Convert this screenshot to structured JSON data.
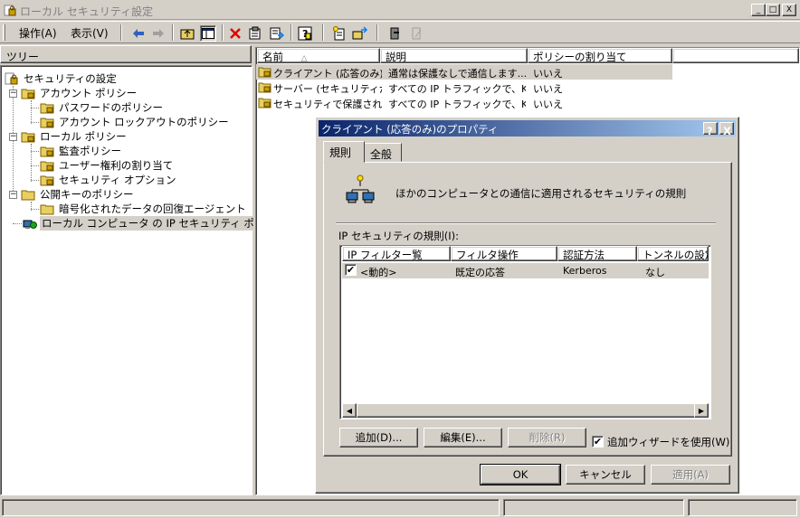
{
  "window": {
    "title": "ローカル セキュリティ設定",
    "minimize": "_",
    "maximize": "□",
    "close": "X"
  },
  "menu": {
    "action": "操作(A)",
    "view": "表示(V)"
  },
  "tree": {
    "header": "ツリー",
    "nodes": [
      {
        "label": "セキュリティの設定",
        "icon": "security-settings-icon"
      },
      {
        "label": "アカウント ポリシー",
        "icon": "folder-icon"
      },
      {
        "label": "パスワードのポリシー",
        "icon": "folder-icon"
      },
      {
        "label": "アカウント ロックアウトのポリシー",
        "icon": "folder-icon"
      },
      {
        "label": "ローカル ポリシー",
        "icon": "folder-icon"
      },
      {
        "label": "監査ポリシー",
        "icon": "folder-icon"
      },
      {
        "label": "ユーザー権利の割り当て",
        "icon": "folder-icon"
      },
      {
        "label": "セキュリティ オプション",
        "icon": "folder-icon"
      },
      {
        "label": "公開キーのポリシー",
        "icon": "folder-icon"
      },
      {
        "label": "暗号化されたデータの回復エージェント",
        "icon": "folder-icon"
      },
      {
        "label": "ローカル コンピュータ の IP セキュリティ ポリシー",
        "icon": "ip-security-icon"
      }
    ]
  },
  "list": {
    "columns": [
      "名前",
      "説明",
      "ポリシーの割り当て"
    ],
    "sort_indicator": "△",
    "rows": [
      {
        "name": "クライアント (応答のみ)",
        "desc": "通常は保護なしで通信します...",
        "assigned": "いいえ"
      },
      {
        "name": "サーバー (セキュリティが...",
        "desc": "すべての IP トラフィックで、Ker...",
        "assigned": "いいえ"
      },
      {
        "name": "セキュリティで保護され...",
        "desc": "すべての IP トラフィックで、Ker...",
        "assigned": "いいえ"
      }
    ]
  },
  "dialog": {
    "title": "クライアント (応答のみ)のプロパティ",
    "help_btn": "?",
    "close_btn": "X",
    "tabs": [
      "規則",
      "全般"
    ],
    "description": "ほかのコンピュータとの通信に適用されるセキュリティの規則",
    "rules_label": "IP セキュリティの規則(I):",
    "rules_columns": [
      "IP フィルター覧",
      "フィルタ操作",
      "認証方法",
      "トンネルの設定"
    ],
    "rules": [
      {
        "checked": "✔",
        "filter": "<動的>",
        "action": "既定の応答",
        "auth": "Kerberos",
        "tunnel": "なし"
      }
    ],
    "add": "追加(D)...",
    "edit": "編集(E)...",
    "remove": "削除(R)",
    "wizard_check": "✔",
    "wizard": "追加ウィザードを使用(W)",
    "ok": "OK",
    "cancel": "キャンセル",
    "apply": "適用(A)"
  }
}
